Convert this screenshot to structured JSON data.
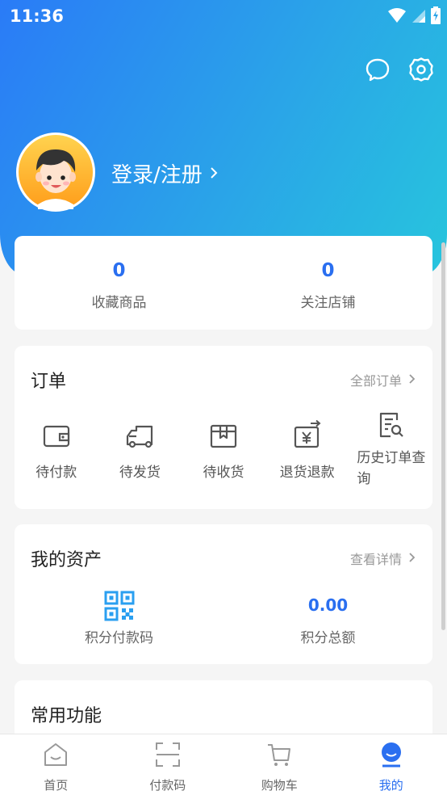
{
  "status_bar": {
    "time": "11:36",
    "icons": [
      "wifi-icon",
      "signal-icon",
      "battery-icon"
    ]
  },
  "header": {
    "icons": [
      "message-icon",
      "settings-icon"
    ],
    "login_label": "登录/注册"
  },
  "stats": [
    {
      "value": "0",
      "label": "收藏商品"
    },
    {
      "value": "0",
      "label": "关注店铺"
    }
  ],
  "orders": {
    "title": "订单",
    "more_label": "全部订单",
    "items": [
      {
        "label": "待付款",
        "icon": "wallet-icon"
      },
      {
        "label": "待发货",
        "icon": "truck-icon"
      },
      {
        "label": "待收货",
        "icon": "package-icon"
      },
      {
        "label": "退货退款",
        "icon": "refund-icon"
      },
      {
        "label": "历史订单查询",
        "icon": "history-search-icon"
      }
    ]
  },
  "assets": {
    "title": "我的资产",
    "more_label": "查看详情",
    "items": [
      {
        "label": "积分付款码",
        "icon": "qr-code-icon"
      },
      {
        "value": "0.00",
        "label": "积分总额"
      }
    ]
  },
  "common": {
    "title": "常用功能"
  },
  "tabbar": [
    {
      "label": "首页",
      "icon": "home-icon",
      "active": false
    },
    {
      "label": "付款码",
      "icon": "scan-icon",
      "active": false
    },
    {
      "label": "购物车",
      "icon": "cart-icon",
      "active": false
    },
    {
      "label": "我的",
      "icon": "profile-icon",
      "active": true
    }
  ],
  "colors": {
    "accent": "#2a6ff0",
    "gradient_start": "#2a7bf7",
    "gradient_end": "#27c5dd"
  }
}
